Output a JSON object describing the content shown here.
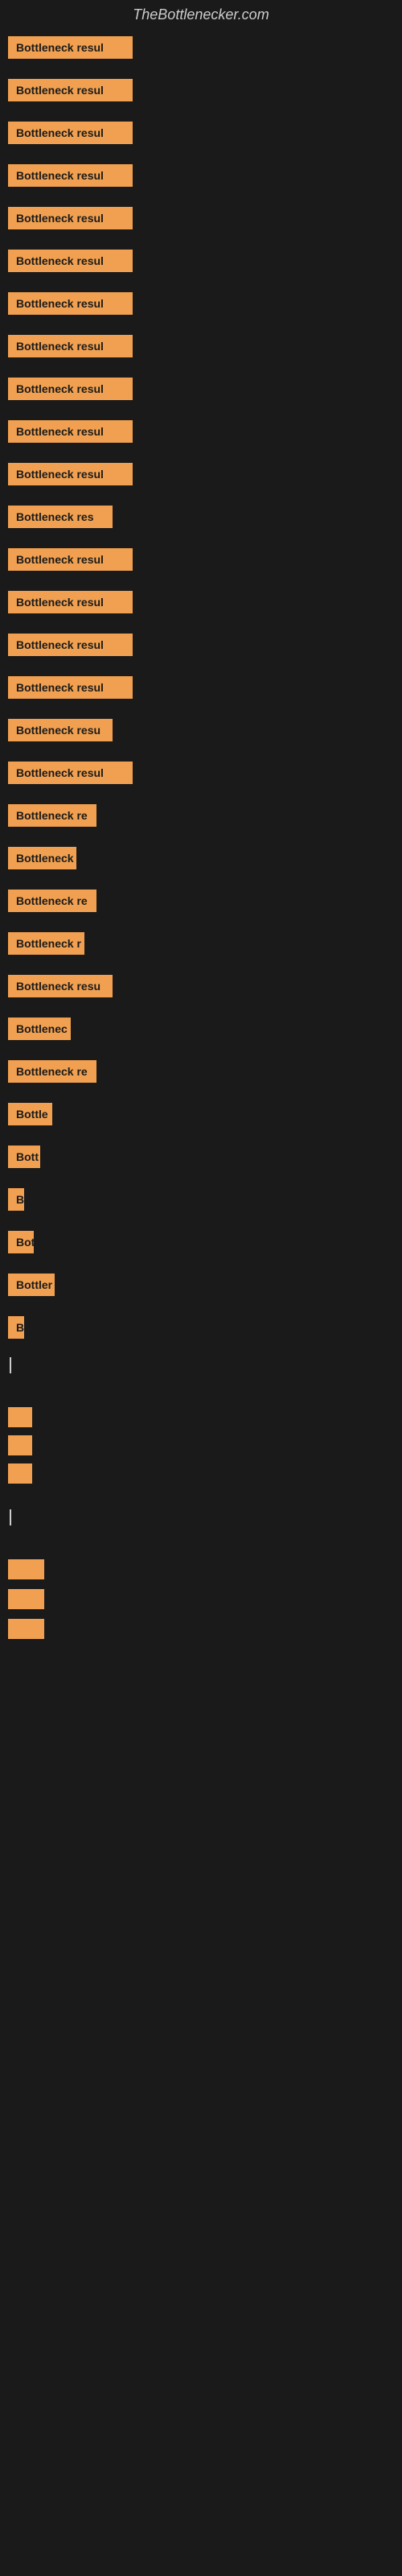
{
  "site": {
    "title": "TheBottlenecker.com"
  },
  "items": [
    {
      "label": "Bottleneck result",
      "width": 155,
      "visible_chars": 16
    },
    {
      "label": "Bottleneck result",
      "width": 155,
      "visible_chars": 16
    },
    {
      "label": "Bottleneck result",
      "width": 155,
      "visible_chars": 16
    },
    {
      "label": "Bottleneck result",
      "width": 155,
      "visible_chars": 16
    },
    {
      "label": "Bottleneck result",
      "width": 155,
      "visible_chars": 16
    },
    {
      "label": "Bottleneck result",
      "width": 155,
      "visible_chars": 16
    },
    {
      "label": "Bottleneck result",
      "width": 155,
      "visible_chars": 16
    },
    {
      "label": "Bottleneck result",
      "width": 155,
      "visible_chars": 16
    },
    {
      "label": "Bottleneck result",
      "width": 155,
      "visible_chars": 16
    },
    {
      "label": "Bottleneck result",
      "width": 155,
      "visible_chars": 16
    },
    {
      "label": "Bottleneck result",
      "width": 155,
      "visible_chars": 16
    },
    {
      "label": "Bottleneck result",
      "width": 130,
      "visible_chars": 14
    },
    {
      "label": "Bottleneck result",
      "width": 155,
      "visible_chars": 16
    },
    {
      "label": "Bottleneck result",
      "width": 155,
      "visible_chars": 16
    },
    {
      "label": "Bottleneck result",
      "width": 155,
      "visible_chars": 16
    },
    {
      "label": "Bottleneck result",
      "width": 155,
      "visible_chars": 16
    },
    {
      "label": "Bottleneck resu",
      "width": 130,
      "visible_chars": 15
    },
    {
      "label": "Bottleneck result",
      "width": 155,
      "visible_chars": 16
    },
    {
      "label": "Bottleneck re",
      "width": 110,
      "visible_chars": 13
    },
    {
      "label": "Bottleneck",
      "width": 85,
      "visible_chars": 10
    },
    {
      "label": "Bottleneck re",
      "width": 110,
      "visible_chars": 13
    },
    {
      "label": "Bottleneck r",
      "width": 95,
      "visible_chars": 12
    },
    {
      "label": "Bottleneck resu",
      "width": 130,
      "visible_chars": 15
    },
    {
      "label": "Bottlenec",
      "width": 78,
      "visible_chars": 9
    },
    {
      "label": "Bottleneck re",
      "width": 110,
      "visible_chars": 13
    },
    {
      "label": "Bottle",
      "width": 55,
      "visible_chars": 6
    },
    {
      "label": "Bott",
      "width": 40,
      "visible_chars": 4
    },
    {
      "label": "B",
      "width": 18,
      "visible_chars": 1
    },
    {
      "label": "Bot",
      "width": 32,
      "visible_chars": 3
    },
    {
      "label": "Bottler",
      "width": 58,
      "visible_chars": 7
    },
    {
      "label": "B",
      "width": 18,
      "visible_chars": 1
    }
  ],
  "cursor": "|"
}
